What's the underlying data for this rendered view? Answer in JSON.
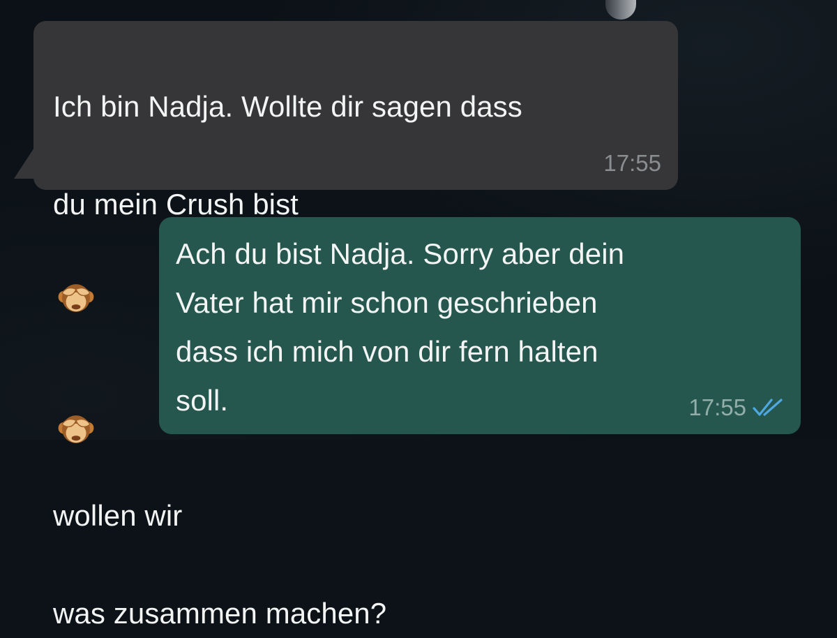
{
  "chat": {
    "incoming": {
      "line1": "Ich bin Nadja. Wollte dir sagen dass",
      "line2_before": "du mein Crush bist",
      "emoji_1": "see-no-evil-monkey-icon",
      "emoji_2": "see-no-evil-monkey-icon",
      "line2_after": "wollen wir",
      "line3": "was zusammen machen?",
      "time": "17:55"
    },
    "outgoing": {
      "text": "Ach du bist Nadja. Sorry aber dein\nVater hat mir schon geschrieben\ndass ich mich von dir fern halten\nsoll.",
      "time": "17:55",
      "status_icon": "double-check-icon",
      "status_color": "#4fa8e0"
    }
  },
  "colors": {
    "background": "#0b1116",
    "incoming_bubble": "#363638",
    "outgoing_bubble": "#25574f",
    "text": "#f3f4f4"
  }
}
